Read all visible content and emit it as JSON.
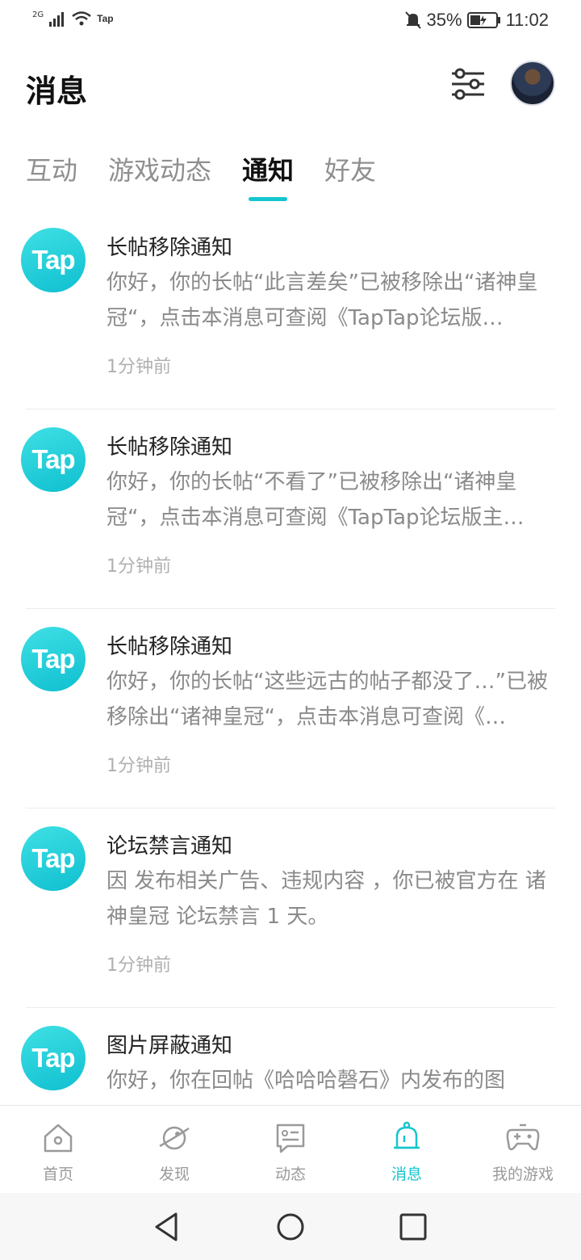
{
  "status_bar": {
    "network": "2G",
    "carrier_app": "Tap",
    "battery": "35%",
    "time": "11:02"
  },
  "header": {
    "title": "消息"
  },
  "tabs": [
    {
      "label": "互动",
      "active": false
    },
    {
      "label": "游戏动态",
      "active": false
    },
    {
      "label": "通知",
      "active": true
    },
    {
      "label": "好友",
      "active": false
    }
  ],
  "notifications": [
    {
      "logo": "Tap",
      "title": "长帖移除通知",
      "body": "你好，你的长帖“此言差矣”已被移除出“诸神皇冠“，点击本消息可查阅《TapTap论坛版…",
      "time": "1分钟前"
    },
    {
      "logo": "Tap",
      "title": "长帖移除通知",
      "body": "你好，你的长帖“不看了”已被移除出“诸神皇冠“，点击本消息可查阅《TapTap论坛版主…",
      "time": "1分钟前"
    },
    {
      "logo": "Tap",
      "title": "长帖移除通知",
      "body": "你好，你的长帖“这些远古的帖子都没了…”已被移除出“诸神皇冠“，点击本消息可查阅《…",
      "time": "1分钟前"
    },
    {
      "logo": "Tap",
      "title": "论坛禁言通知",
      "body": "因 发布相关广告、违规内容 ，你已被官方在 诸神皇冠 论坛禁言 1 天。",
      "time": "1分钟前"
    },
    {
      "logo": "Tap",
      "title": "图片屏蔽通知",
      "body": "你好，你在回帖《哈哈哈磬石》内发布的图",
      "time": ""
    }
  ],
  "bottom_nav": [
    {
      "label": "首页",
      "icon": "home-icon",
      "active": false
    },
    {
      "label": "发现",
      "icon": "planet-icon",
      "active": false
    },
    {
      "label": "动态",
      "icon": "chat-card-icon",
      "active": false
    },
    {
      "label": "消息",
      "icon": "bell-icon",
      "active": true
    },
    {
      "label": "我的游戏",
      "icon": "gamepad-icon",
      "active": false
    }
  ],
  "colors": {
    "accent": "#15c5ce",
    "muted_text": "#8a8a8a",
    "time_text": "#b0b0b0"
  }
}
